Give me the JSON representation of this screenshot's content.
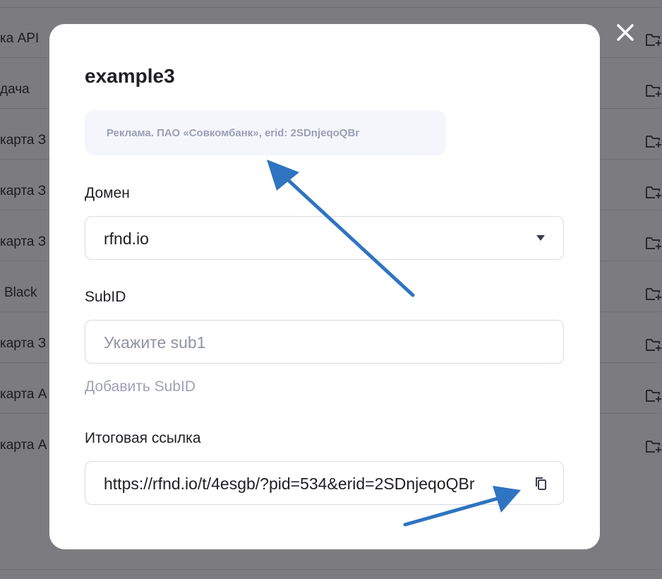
{
  "background": {
    "rows": [
      {
        "label": "ка API"
      },
      {
        "label": "дача"
      },
      {
        "label": "карта З"
      },
      {
        "label": "карта З"
      },
      {
        "label": "карта З"
      },
      {
        "label": "Black"
      },
      {
        "label": "карта З"
      },
      {
        "label": "карта А"
      },
      {
        "label": "карта А"
      }
    ],
    "row_icon": "folder-add-icon"
  },
  "modal": {
    "title": "example3",
    "ad_note": "Реклама. ПАО «Совкомбанк», erid: 2SDnjeqoQBr",
    "domain": {
      "label": "Домен",
      "value": "rfnd.io"
    },
    "subid": {
      "label": "SubID",
      "placeholder": "Укажите sub1",
      "add_label": "Добавить SubID"
    },
    "final_link": {
      "label": "Итоговая ссылка",
      "value": "https://rfnd.io/t/4esgb/?pid=534&erid=2SDnjeqoQBr"
    },
    "close_icon": "close-icon",
    "copy_icon": "copy-icon"
  },
  "annotation_color": "#2f74c0"
}
